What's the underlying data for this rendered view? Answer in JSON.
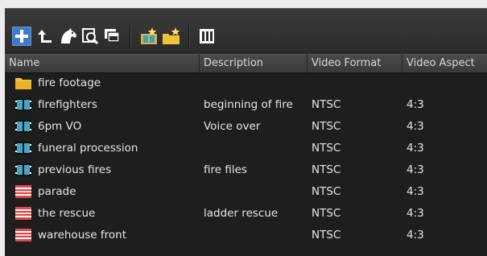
{
  "toolbar": {
    "buttons": [
      {
        "icon": "add-plus-icon"
      },
      {
        "icon": "up-level-icon"
      },
      {
        "icon": "horse-head-icon"
      },
      {
        "icon": "find-magnifier-icon"
      },
      {
        "icon": "clip-stack-icon"
      },
      {
        "icon": "new-sequence-folder-icon"
      },
      {
        "icon": "new-folder-icon"
      },
      {
        "icon": "columns-view-icon"
      }
    ]
  },
  "columns": [
    "Name",
    "Description",
    "Video Format",
    "Video Aspect"
  ],
  "rows": [
    {
      "type": "folder",
      "name": "fire footage",
      "description": "",
      "format": "",
      "aspect": ""
    },
    {
      "type": "clip",
      "name": "firefighters",
      "description": "beginning of fire",
      "format": "NTSC",
      "aspect": "4:3"
    },
    {
      "type": "clip",
      "name": "6pm VO",
      "description": "Voice over",
      "format": "NTSC",
      "aspect": "4:3"
    },
    {
      "type": "clip",
      "name": "funeral procession",
      "description": "",
      "format": "NTSC",
      "aspect": "4:3"
    },
    {
      "type": "clip",
      "name": "previous fires",
      "description": "fire files",
      "format": "NTSC",
      "aspect": "4:3"
    },
    {
      "type": "sequence",
      "name": "parade",
      "description": "",
      "format": "NTSC",
      "aspect": "4:3"
    },
    {
      "type": "sequence",
      "name": "the rescue",
      "description": "ladder rescue",
      "format": "NTSC",
      "aspect": "4:3"
    },
    {
      "type": "sequence",
      "name": "warehouse front",
      "description": "",
      "format": "NTSC",
      "aspect": "4:3"
    }
  ],
  "colors": {
    "background": "#1e1e1e",
    "text": "#e6e6e6",
    "folder": "#f2c23c",
    "clip": "#46a6c6",
    "sequence": "#e04848"
  }
}
